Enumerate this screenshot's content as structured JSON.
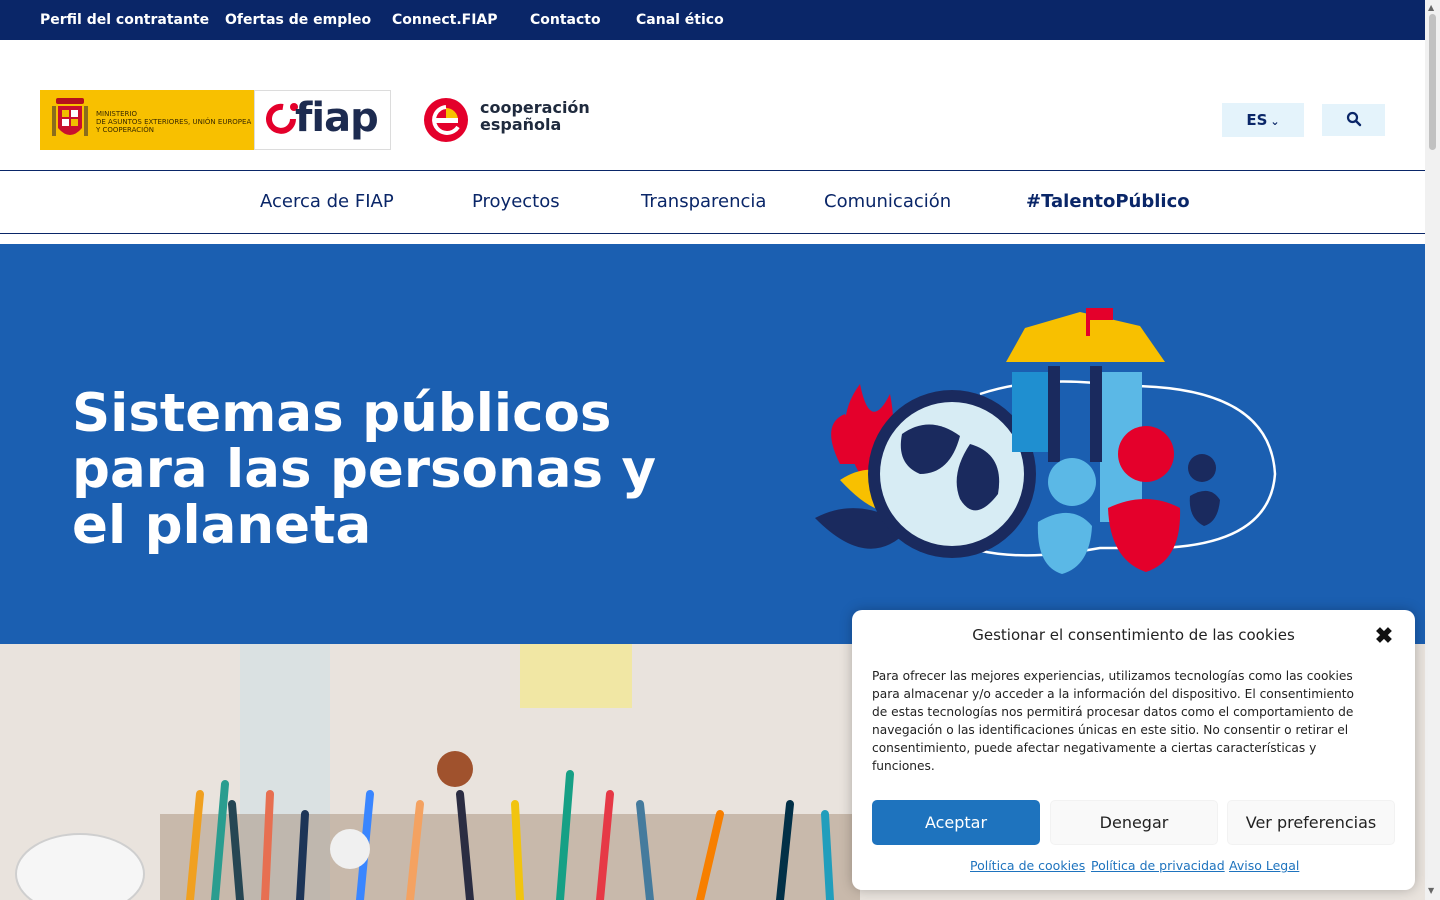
{
  "topbar": {
    "links": [
      "Perfil del contratante",
      "Ofertas de empleo",
      "Connect.FIAP",
      "Contacto",
      "Canal ético"
    ]
  },
  "header": {
    "ministry_text": "MINISTERIO\nDE ASUNTOS EXTERIORES, UNIÓN EUROPEA\nY COOPERACIÓN",
    "fiap_wordmark": "fiap",
    "cooperacion_text": "cooperación\nespañola",
    "language": "ES",
    "icons": {
      "language_toggle": "chevron-down-icon",
      "search": "search-icon"
    }
  },
  "nav": {
    "items": [
      "Acerca de FIAP",
      "Proyectos",
      "Transparencia",
      "Comunicación",
      "#TalentoPúblico"
    ]
  },
  "hero": {
    "title": "Sistemas públicos para las personas y el planeta"
  },
  "cookie_dialog": {
    "title": "Gestionar el consentimiento de las cookies",
    "body": "Para ofrecer las mejores experiencias, utilizamos tecnologías como las cookies para almacenar y/o acceder a la información del dispositivo. El consentimiento de estas tecnologías nos permitirá procesar datos como el comportamiento de navegación o las identificaciones únicas en este sitio. No consentir o retirar el consentimiento, puede afectar negativamente a ciertas características y funciones.",
    "close_label": "✖",
    "buttons": {
      "accept": "Aceptar",
      "deny": "Denegar",
      "preferences": "Ver preferencias"
    },
    "links": [
      "Política de cookies",
      "Política de privacidad",
      "Aviso Legal"
    ]
  },
  "colors": {
    "topbar": "#0a2668",
    "hero": "#1b5fb1",
    "accent_yellow": "#f8c000",
    "accent_red": "#e4002b",
    "button_primary": "#1e73be"
  }
}
